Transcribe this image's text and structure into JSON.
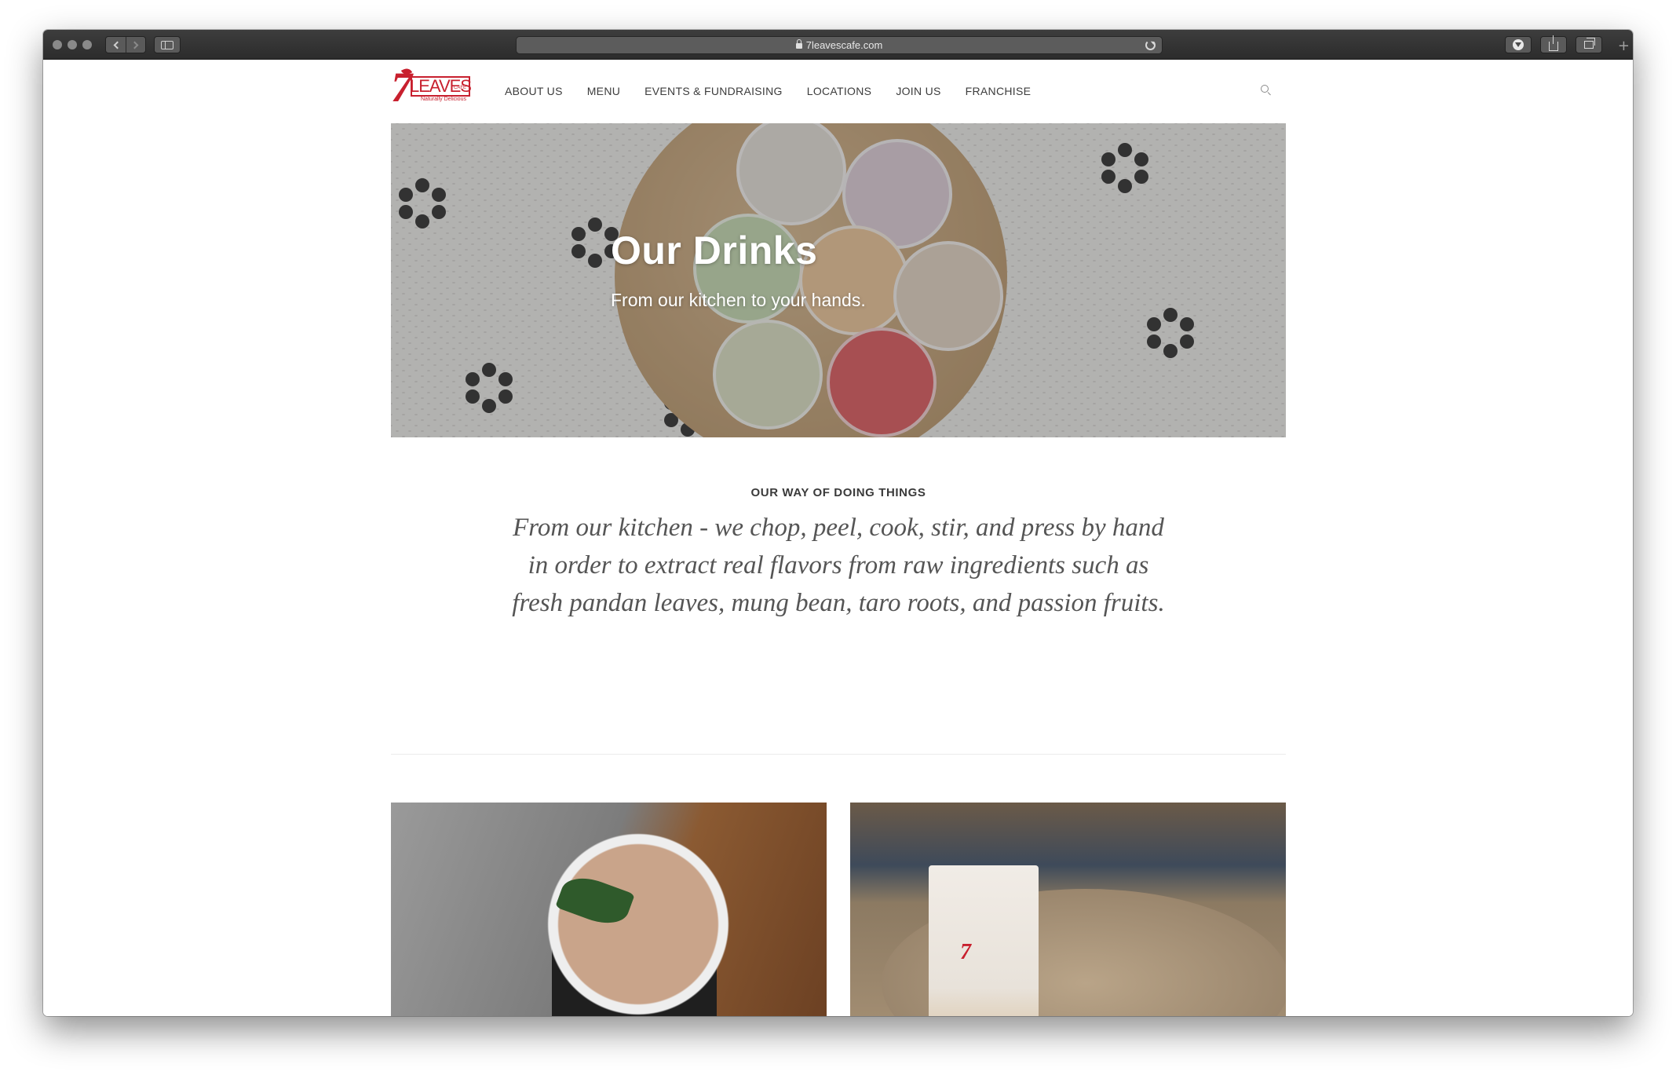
{
  "browser": {
    "url": "7leavescafe.com"
  },
  "site": {
    "logo": {
      "number": "7",
      "word": "LEAVES",
      "sub": "CAFE",
      "tagline": "Naturally Delicious"
    },
    "nav": [
      {
        "label": "ABOUT US"
      },
      {
        "label": "MENU"
      },
      {
        "label": "EVENTS & FUNDRAISING"
      },
      {
        "label": "LOCATIONS"
      },
      {
        "label": "JOIN US"
      },
      {
        "label": "FRANCHISE"
      }
    ],
    "icons": {
      "search": "search-icon"
    }
  },
  "hero": {
    "title": "Our Drinks",
    "subtitle": "From our kitchen to your hands."
  },
  "intro": {
    "kicker": "OUR WAY OF DOING THINGS",
    "quote": "From our kitchen - we chop, peel, cook, stir, and press by hand in order to extract real flavors from raw ingredients such as fresh pandan leaves, mung bean, taro roots, and passion fruits."
  },
  "colors": {
    "brand_red": "#c8202e",
    "text_dark": "#3a3a3a",
    "quote_text": "#555555"
  }
}
